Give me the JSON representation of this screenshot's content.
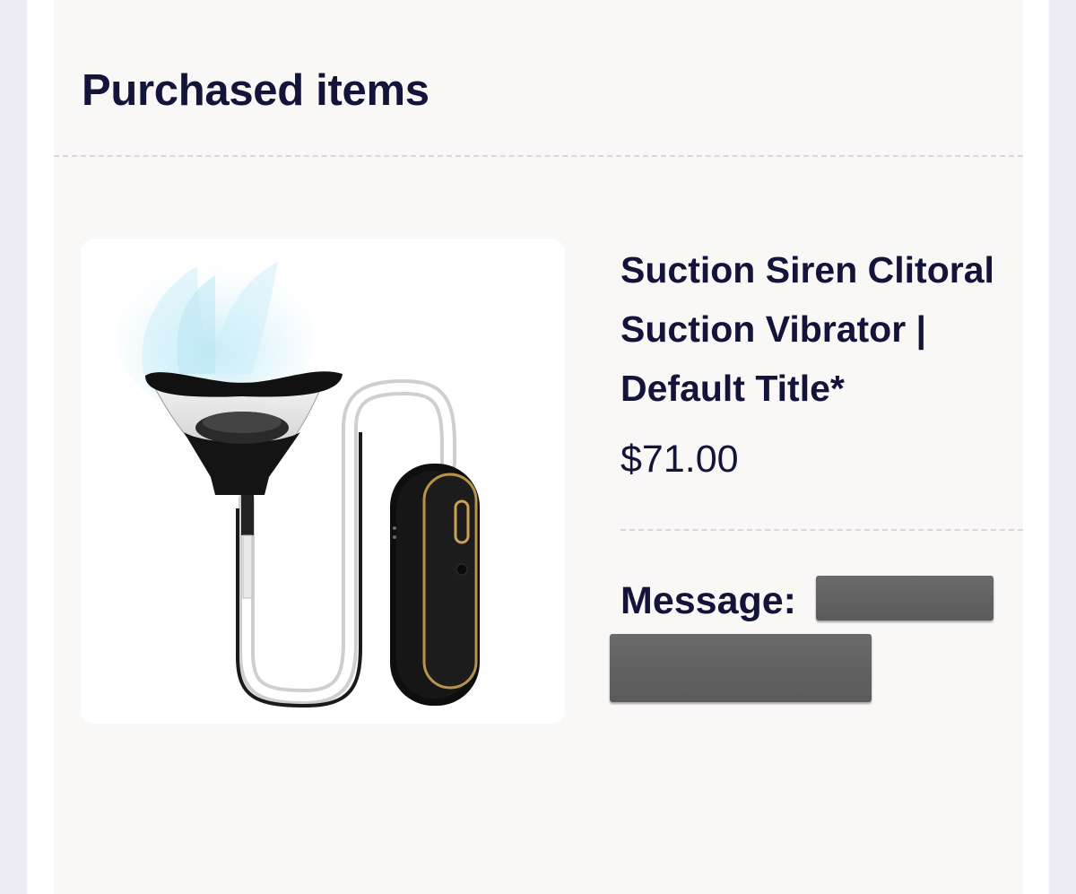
{
  "section": {
    "title": "Purchased items"
  },
  "item": {
    "name": "Suction Siren Clitoral Suction Vibrator | Default Title*",
    "price": "$71.00",
    "image_icon": "product-photo",
    "message_label": "Message:"
  },
  "colors": {
    "page_background": "#ececf2",
    "panel_background": "#faf8f7",
    "text": "#14143a",
    "redaction": "#5f5f5f",
    "divider": "#d8d8dc"
  }
}
